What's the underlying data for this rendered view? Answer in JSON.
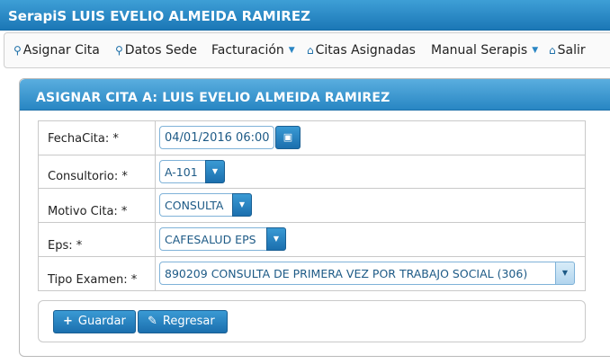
{
  "app": {
    "title": "SerapiS LUIS EVELIO ALMEIDA RAMIREZ"
  },
  "menu": {
    "items": [
      {
        "label": "Asignar Cita",
        "icon": "search-icon"
      },
      {
        "label": "Datos Sede",
        "icon": "search-icon"
      },
      {
        "label": "Facturación",
        "dropdown": true
      },
      {
        "label": "Citas Asignadas",
        "icon": "home-icon"
      },
      {
        "label": "Manual Serapis",
        "dropdown": true
      },
      {
        "label": "Salir",
        "icon": "home-icon"
      }
    ]
  },
  "panel": {
    "title": "ASIGNAR CITA A: LUIS EVELIO ALMEIDA RAMIREZ"
  },
  "form": {
    "fecha_label": "FechaCita: *",
    "fecha_value": "04/01/2016 06:00",
    "consultorio_label": "Consultorio: *",
    "consultorio_value": "A-101",
    "motivo_label": "Motivo Cita: *",
    "motivo_value": "CONSULTA",
    "eps_label": "Eps: *",
    "eps_value": "CAFESALUD EPS",
    "examen_label": "Tipo Examen: *",
    "examen_value": "890209 CONSULTA DE PRIMERA VEZ POR TRABAJO SOCIAL (306)"
  },
  "buttons": {
    "save": "Guardar",
    "back": "Regresar"
  },
  "colors": {
    "accent": "#1b77b6",
    "field_text": "#1d5a86"
  }
}
